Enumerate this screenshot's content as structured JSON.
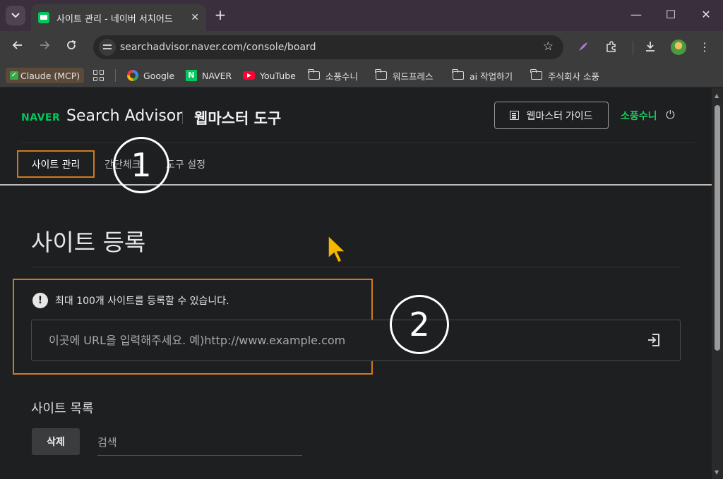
{
  "browser": {
    "tab_title": "사이트 관리 - 네이버 서치어드",
    "tab_close": "✕",
    "new_tab": "+",
    "url": "searchadvisor.naver.com/console/board",
    "window_controls": [
      "—",
      "☐",
      "✕"
    ],
    "bookmarks": [
      {
        "label": "Claude (MCP)",
        "icon": "check-icon"
      },
      {
        "label": "Google",
        "icon": "google-icon"
      },
      {
        "label": "NAVER",
        "icon": "naver-icon"
      },
      {
        "label": "YouTube",
        "icon": "youtube-icon"
      },
      {
        "label": "소풍수니",
        "icon": "folder-icon"
      },
      {
        "label": "워드프레스",
        "icon": "folder-icon"
      },
      {
        "label": "ai 작업하기",
        "icon": "folder-icon"
      },
      {
        "label": "주식회사 소풍",
        "icon": "folder-icon"
      }
    ]
  },
  "header": {
    "logo": "NAVER",
    "product": "Search Advisor",
    "tool": "웹마스터 도구",
    "guide_button": "웹마스터 가이드",
    "user": "소풍수니"
  },
  "nav": {
    "tabs": [
      "사이트 관리",
      "간단체크",
      "도구 설정"
    ]
  },
  "annotations": {
    "circle_1": "1",
    "circle_2": "2",
    "highlight_color": "#d07a1f"
  },
  "register": {
    "title": "사이트 등록",
    "notice": "최대 100개 사이트를 등록할 수 있습니다.",
    "url_placeholder": "이곳에 URL을 입력해주세요. 예)http://www.example.com"
  },
  "site_list": {
    "title": "사이트 목록",
    "delete_button": "삭제",
    "search_placeholder": "검색"
  },
  "colors": {
    "naver_green": "#03c75a",
    "user_green": "#19ce60"
  }
}
